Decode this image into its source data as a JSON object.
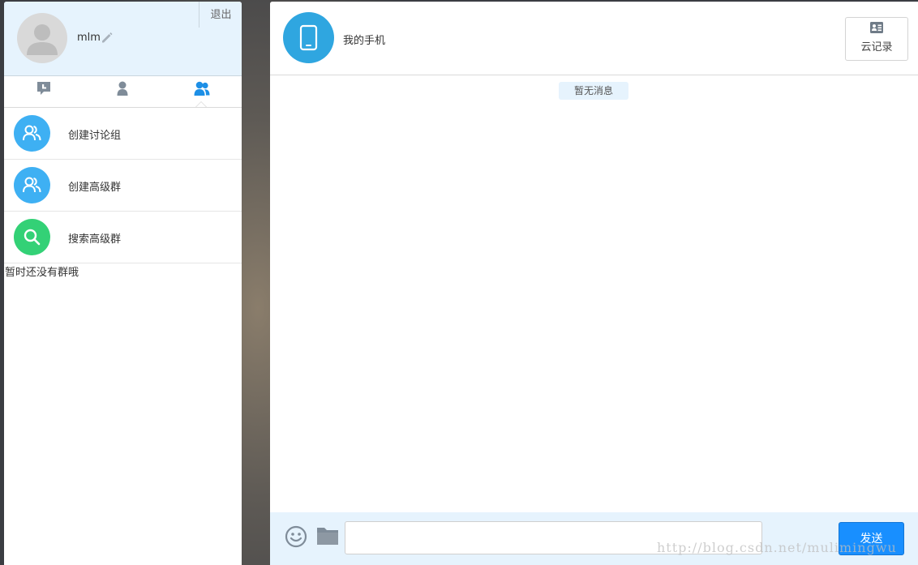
{
  "sidebar": {
    "user": {
      "name": "mlm"
    },
    "logout_label": "退出",
    "tabs": [
      {
        "icon": "chat-bubble-icon",
        "active": false
      },
      {
        "icon": "person-icon",
        "active": false
      },
      {
        "icon": "group-icon",
        "active": true
      }
    ],
    "menu_items": [
      {
        "label": "创建讨论组",
        "icon": "group-icon",
        "color": "#3eb0f3"
      },
      {
        "label": "创建高级群",
        "icon": "group-icon",
        "color": "#3eb0f3"
      },
      {
        "label": "搜索高级群",
        "icon": "search-icon",
        "color": "#33d176"
      }
    ],
    "empty_text": "暂时还没有群哦"
  },
  "chat": {
    "contact_name": "我的手机",
    "contact_icon": "phone-icon",
    "cloud_button_label": "云记录",
    "no_message_text": "暂无消息",
    "input": {
      "value": "",
      "placeholder": ""
    },
    "send_label": "发送"
  },
  "watermark": "http://blog.csdn.net/mulimingwu",
  "colors": {
    "accent": "#188fff",
    "header_bg": "#e6f3fd",
    "active_tab": "#1d8fe6",
    "inactive_tab": "#7f8c99"
  }
}
